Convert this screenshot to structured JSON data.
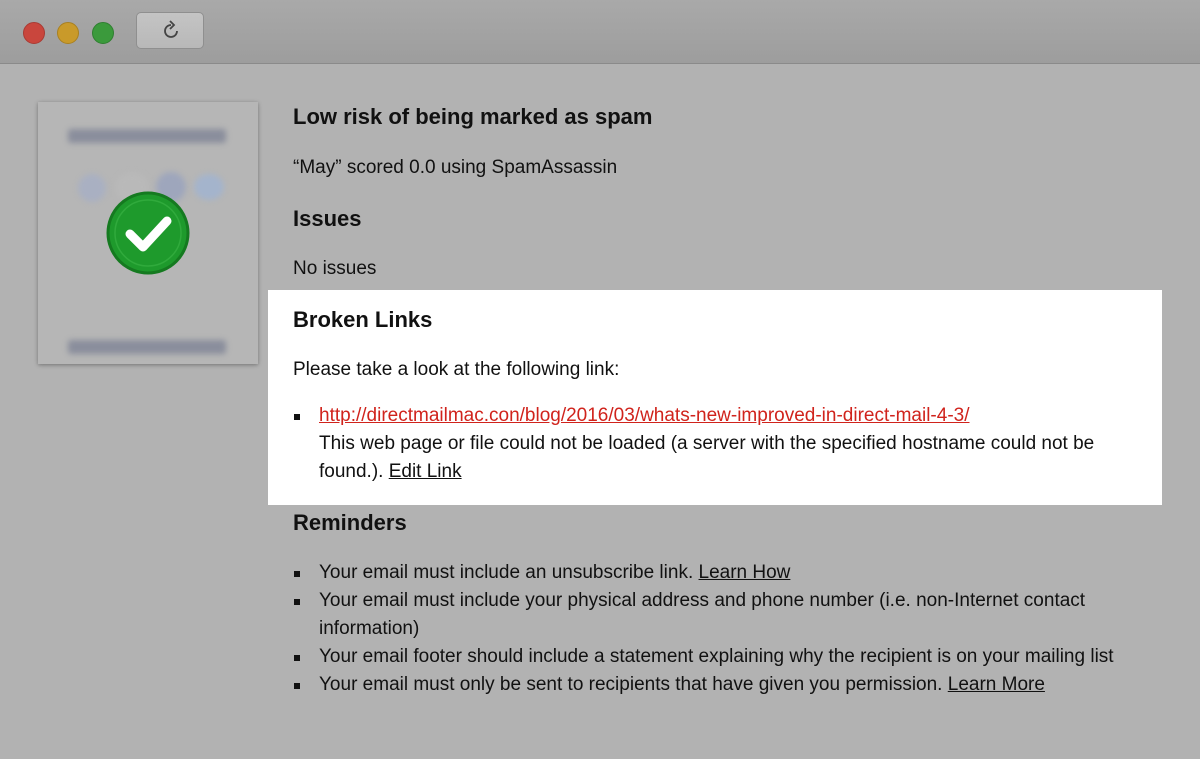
{
  "window": {
    "reload_icon": "reload-icon"
  },
  "thumbnail": {
    "status_icon": "checkmark-icon",
    "status_color": "#1e9a2c"
  },
  "spam": {
    "title": "Low risk of being marked as spam",
    "score_text": "“May” scored 0.0 using SpamAssassin"
  },
  "issues": {
    "title": "Issues",
    "text": "No issues"
  },
  "broken_links": {
    "title": "Broken Links",
    "intro": "Please take a look at the following link:",
    "items": [
      {
        "url": "http://directmailmac.con/blog/2016/03/whats-new-improved-in-direct-mail-4-3/",
        "message": "This web page or file could not be loaded (a server with the specified hostname could not be found.).",
        "action": "Edit Link"
      }
    ]
  },
  "reminders": {
    "title": "Reminders",
    "items": [
      {
        "text": "Your email must include an unsubscribe link.",
        "link": "Learn How"
      },
      {
        "text": "Your email must include your physical address and phone number (i.e. non-Internet contact information)",
        "link": ""
      },
      {
        "text": "Your email footer should include a statement explaining why the recipient is on your mailing list",
        "link": ""
      },
      {
        "text": "Your email must only be sent to recipients that have given you permission.",
        "link": "Learn More"
      }
    ]
  },
  "colors": {
    "link_error": "#d0231c",
    "highlight_bg": "#ffffff",
    "window_bg": "#b2b2b2"
  }
}
